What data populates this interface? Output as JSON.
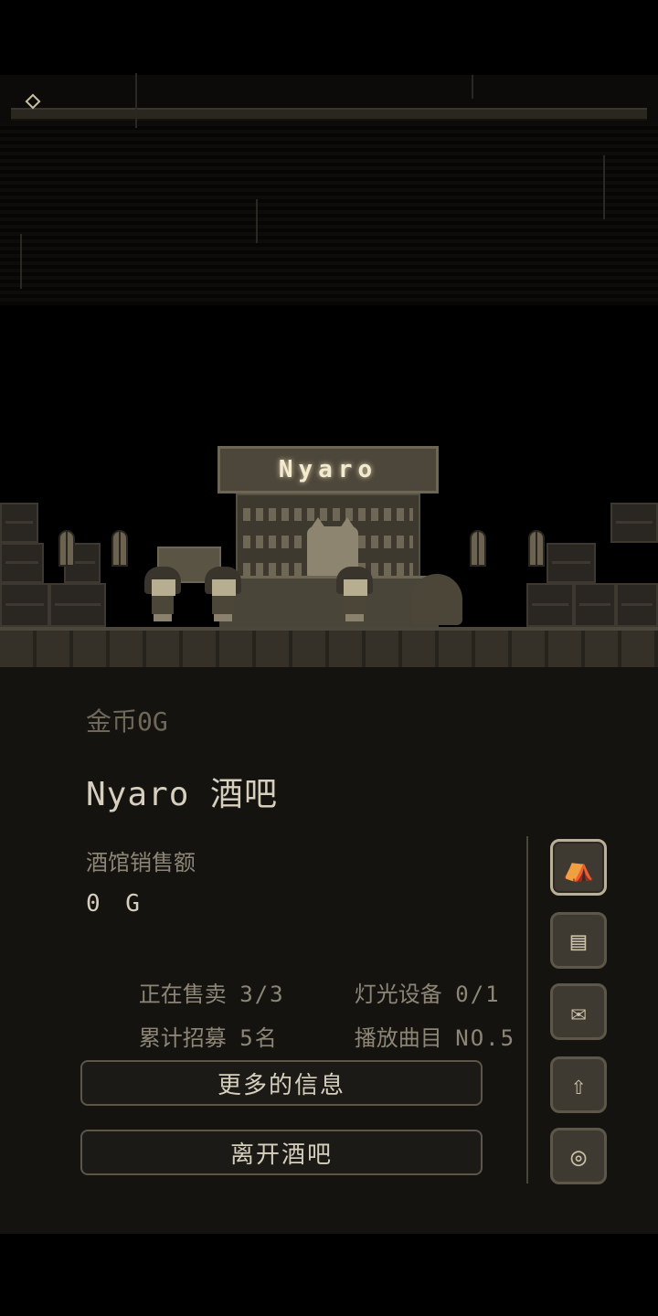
{
  "scene": {
    "sign_text": "Nyaro"
  },
  "info": {
    "gold": "金币0G",
    "bar_name": "Nyaro 酒吧",
    "sales_label": "酒馆销售额",
    "sales_value": "0 G",
    "selling_label": "正在售卖",
    "selling_value": "3/3",
    "lighting_label": "灯光设备",
    "lighting_value": "0/1",
    "recruit_label": "累计招募",
    "recruit_value": "5名",
    "track_label": "播放曲目",
    "track_value": "NO.5"
  },
  "buttons": {
    "more_info": "更多的信息",
    "leave": "离开酒吧"
  },
  "side_menu": [
    {
      "icon": "tent-icon",
      "glyph": "⛺",
      "active": true
    },
    {
      "icon": "menu-list-icon",
      "glyph": "▤",
      "active": false
    },
    {
      "icon": "scroll-icon",
      "glyph": "✉",
      "active": false
    },
    {
      "icon": "upgrade-arrow-icon",
      "glyph": "⇧",
      "active": false
    },
    {
      "icon": "record-disc-icon",
      "glyph": "◎",
      "active": false
    }
  ],
  "colors": {
    "background": "#000000",
    "panel": "#151310",
    "text_primary": "#d6cfbd",
    "text_secondary": "#8d8676"
  }
}
